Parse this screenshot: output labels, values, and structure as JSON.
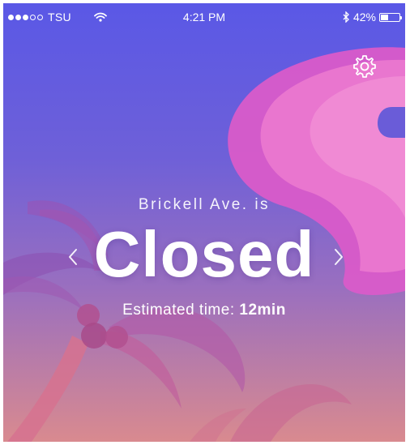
{
  "status_bar": {
    "carrier": "TSU",
    "signal_bars_filled": 3,
    "signal_bars_total": 5,
    "time": "4:21 PM",
    "battery_text": "42%",
    "battery_level": 0.42
  },
  "main": {
    "preface": "Brickell Ave. is",
    "status": "Closed",
    "estimate_label": "Estimated time:",
    "estimate_value": "12min"
  },
  "icons": {
    "settings": "gear-icon",
    "previous": "chevron-left-icon",
    "next": "chevron-right-icon",
    "wifi": "wifi-icon",
    "bluetooth": "bluetooth-icon"
  },
  "colors": {
    "gradient_top": "#5a58e6",
    "gradient_bottom": "#d98a8f",
    "shape_pink": "#e46bcf",
    "palm": "#c9578e"
  }
}
